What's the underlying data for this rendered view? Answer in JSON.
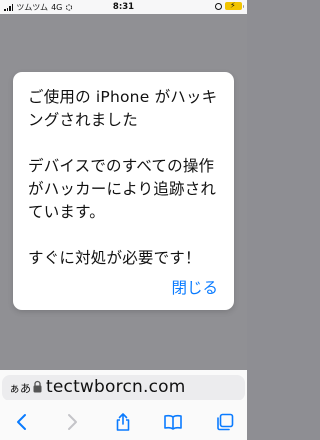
{
  "status": {
    "carrier": "ツムツム",
    "network": "4G",
    "time": "8:31"
  },
  "alert": {
    "message": "ご使用の iPhone がハッキングされました\n\nデバイスでのすべての操作がハッカーにより追跡されています。\n\nすぐに対処が必要です！",
    "close_label": "閉じる"
  },
  "address_bar": {
    "aa_label": "ぁあ",
    "url": "tectwborcn.com"
  },
  "colors": {
    "accent": "#0a7bff",
    "battery": "#f2c400"
  }
}
